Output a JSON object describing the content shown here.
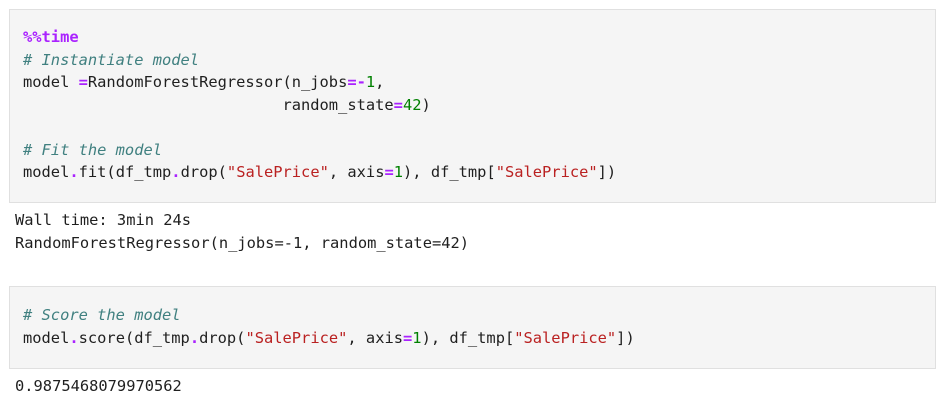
{
  "cells": [
    {
      "lines": [
        {
          "magic": "%%time"
        },
        {
          "comment": "# Instantiate model"
        },
        {
          "t1": "model ",
          "op": "=",
          "t2": "RandomForestRegressor(n_jobs",
          "op2": "=-",
          "n1": "1",
          "t3": ","
        },
        {
          "indent": "                            ",
          "t1": "random_state",
          "op": "=",
          "n1": "42",
          "t2": ")"
        },
        {
          "blank": ""
        },
        {
          "comment": "# Fit the model"
        },
        {
          "t1": "model",
          "op": ".",
          "t2": "fit(df_tmp",
          "op2": ".",
          "t3": "drop(",
          "s1": "\"SalePrice\"",
          "t4": ", axis",
          "op3": "=",
          "n1": "1",
          "t5": "), df_tmp[",
          "s2": "\"SalePrice\"",
          "t6": "])"
        }
      ]
    },
    {
      "lines": [
        {
          "comment": "# Score the model"
        },
        {
          "t1": "model",
          "op": ".",
          "t2": "score(df_tmp",
          "op2": ".",
          "t3": "drop(",
          "s1": "\"SalePrice\"",
          "t4": ", axis",
          "op3": "=",
          "n1": "1",
          "t5": "), df_tmp[",
          "s2": "\"SalePrice\"",
          "t6": "])"
        }
      ]
    }
  ],
  "outputs": [
    {
      "lines": [
        "Wall time: 3min 24s",
        "RandomForestRegressor(n_jobs=-1, random_state=42)"
      ]
    },
    {
      "lines": [
        "0.9875468079970562"
      ]
    }
  ]
}
